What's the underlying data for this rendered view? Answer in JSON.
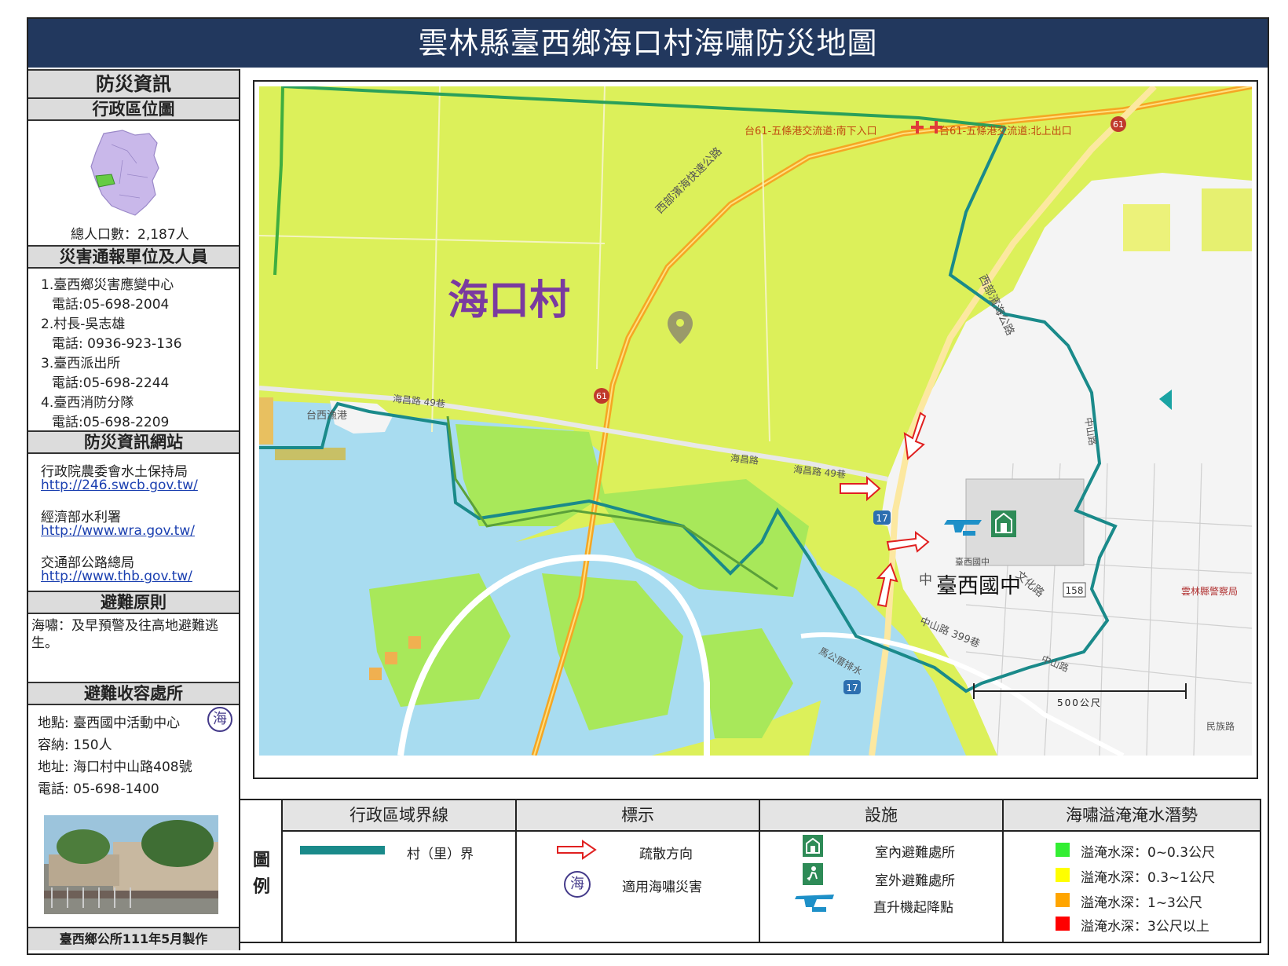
{
  "title": "雲林縣臺西鄉海口村海嘯防災地圖",
  "sidebar": {
    "section_info": "防災資訊",
    "section_admin": "行政區位圖",
    "population": "總人口數：2,187人",
    "section_contacts": "災害通報單位及人員",
    "contacts": [
      "1.臺西鄉災害應變中心",
      "電話:05-698-2004",
      "2.村長-吳志雄",
      "電話: 0936-923-136",
      "3.臺西派出所",
      "電話:05-698-2244",
      "4.臺西消防分隊",
      "電話:05-698-2209"
    ],
    "section_websites": "防災資訊網站",
    "websites": [
      {
        "name": "行政院農委會水土保持局",
        "url": "http://246.swcb.gov.tw/"
      },
      {
        "name": "經濟部水利署",
        "url": "http://www.wra.gov.tw/"
      },
      {
        "name": "交通部公路總局",
        "url": "http://www.thb.gov.tw/"
      }
    ],
    "section_principle": "避難原則",
    "principle": [
      "海嘯：及早預警及往高地避難逃",
      "生。"
    ],
    "section_shelter": "避難收容處所",
    "shelter": {
      "place": "地點: 臺西國中活動中心",
      "capacity": "容納: 150人",
      "address": "地址: 海口村中山路408號",
      "phone": "電話: 05-698-1400",
      "badge": "海"
    },
    "footer": "臺西鄉公所111年5月製作"
  },
  "map": {
    "village_label": "海口村",
    "school_label": "臺西國中",
    "school_small": "臺西國中",
    "labels": {
      "interchange_south": "台61-五條港交流道:南下入口",
      "interchange_north": "台61-五條港交流道:北上出口",
      "expressway": "西部濱海快速公路",
      "coastal_road": "西部濱海公路",
      "haiying_49": "海昌路 49巷",
      "haiying_49b": "海昌路 49巷",
      "haiying": "海昌路",
      "port": "台西漁港",
      "zhongshan": "中山路",
      "zhongshan_399": "中山路 399巷",
      "zhongshan_east": "中山路",
      "wenhua": "文化路",
      "zhong": "中",
      "drainage": "馬公厝排水",
      "police": "雲林縣警察局",
      "minzu": "民族路",
      "route17a": "17",
      "route17b": "17",
      "route61a": "61",
      "route61b": "61",
      "route158": "158",
      "scale": "500公尺"
    }
  },
  "legend": {
    "side_label": [
      "圖",
      "例"
    ],
    "col_boundary": "行政區域界線",
    "col_marks": "標示",
    "col_facilities": "設施",
    "col_inundation": "海嘯溢淹淹水潛勢",
    "boundary_item": "村（里）界",
    "marks": [
      "疏散方向",
      "適用海嘯災害"
    ],
    "mark_badge": "海",
    "facilities": [
      "室內避難處所",
      "室外避難處所",
      "直升機起降點"
    ],
    "inundation": [
      {
        "label": "溢淹水深：0~0.3公尺",
        "color": "#33ee33"
      },
      {
        "label": "溢淹水深：0.3~1公尺",
        "color": "#ffff00"
      },
      {
        "label": "溢淹水深：1~3公尺",
        "color": "#ffa500"
      },
      {
        "label": "溢淹水深：3公尺以上",
        "color": "#ff0000"
      }
    ]
  },
  "colors": {
    "title_bg": "#22385e",
    "boundary": "#1a8a8a",
    "water": "#a8dcf0",
    "yellow_green": "#dcf05a",
    "green": "#9ce65a"
  }
}
